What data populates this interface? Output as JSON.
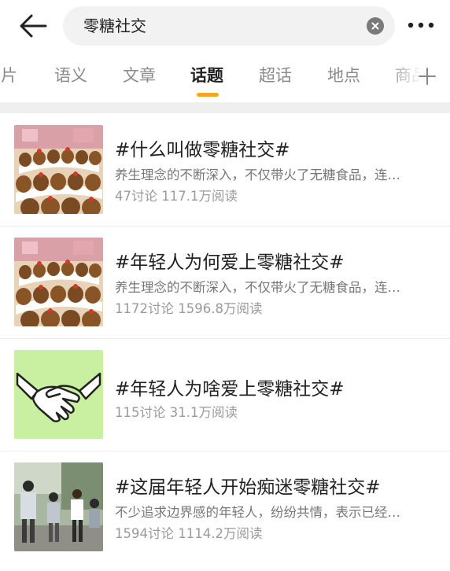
{
  "header": {
    "search_query": "零糖社交",
    "icons": {
      "back": "back-arrow-icon",
      "clear": "clear-icon",
      "more": "more-icon"
    }
  },
  "tabs": [
    {
      "label": "图片"
    },
    {
      "label": "语义"
    },
    {
      "label": "文章"
    },
    {
      "label": "话题",
      "active": true
    },
    {
      "label": "超话"
    },
    {
      "label": "地点"
    },
    {
      "label": "商品"
    }
  ],
  "colors": {
    "accent": "#f5a623",
    "thumb_green": "#c8f0a0"
  },
  "topics": [
    {
      "title": "#什么叫做零糖社交#",
      "desc": "养生理念的不断深入，不仅带火了无糖食品，连…",
      "stats": "47讨论 117.1万阅读",
      "thumb": "plush-toys"
    },
    {
      "title": "#年轻人为何爱上零糖社交#",
      "desc": "养生理念的不断深入，不仅带火了无糖食品，连…",
      "stats": "1172讨论 1596.8万阅读",
      "thumb": "plush-toys"
    },
    {
      "title": "#年轻人为啥爱上零糖社交#",
      "desc": "",
      "stats": "115讨论 31.1万阅读",
      "thumb": "handshake"
    },
    {
      "title": "#这届年轻人开始痴迷零糖社交#",
      "desc": "不少追求边界感的年轻人，纷纷共情，表示已经…",
      "stats": "1594讨论 1114.2万阅读",
      "thumb": "people-photo"
    }
  ]
}
